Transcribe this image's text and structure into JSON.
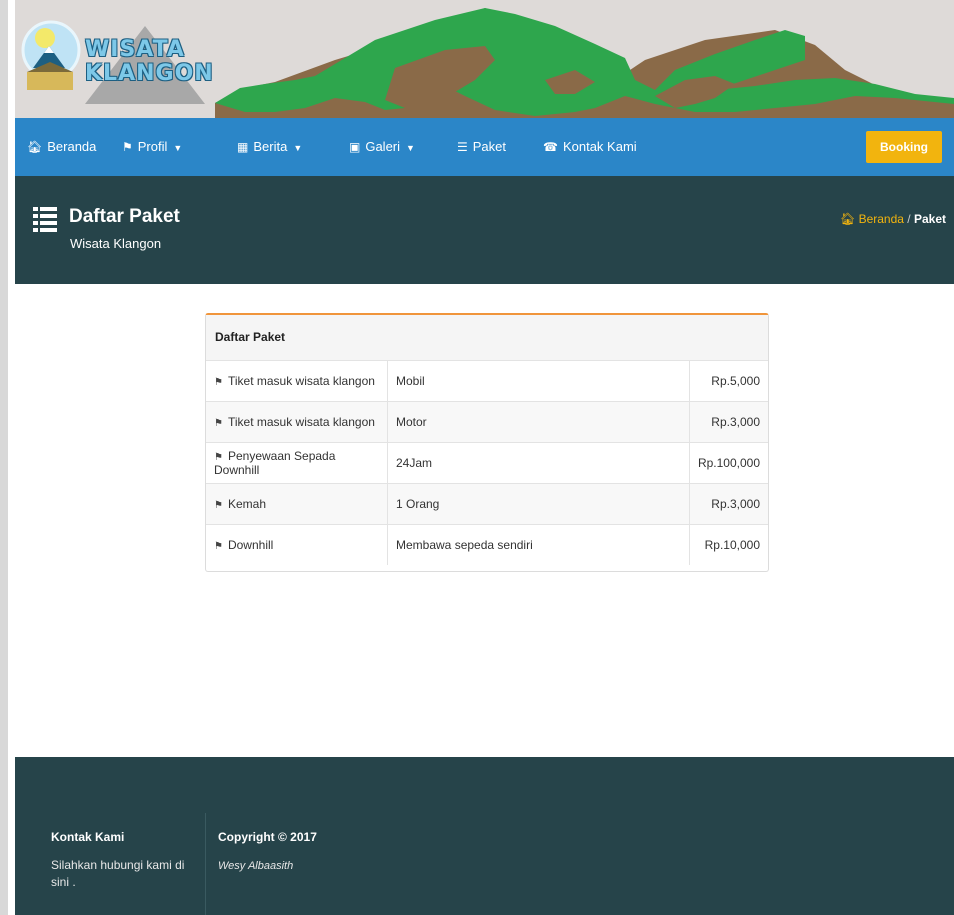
{
  "site": {
    "logo_line1": "WISATA",
    "logo_line2": "KLANGON"
  },
  "nav": {
    "items": [
      {
        "icon": "home-icon",
        "label": "Beranda",
        "dropdown": false
      },
      {
        "icon": "flag-icon",
        "label": "Profil",
        "dropdown": true
      },
      {
        "icon": "newspaper-icon",
        "label": "Berita",
        "dropdown": true
      },
      {
        "icon": "image-icon",
        "label": "Galeri",
        "dropdown": true
      },
      {
        "icon": "list-icon",
        "label": "Paket",
        "dropdown": false
      },
      {
        "icon": "phone-icon",
        "label": "Kontak Kami",
        "dropdown": false
      }
    ],
    "booking_label": "Booking"
  },
  "page_header": {
    "title": "Daftar Paket",
    "subtitle": "Wisata Klangon",
    "breadcrumb_home": "Beranda",
    "breadcrumb_separator": "/",
    "breadcrumb_current": "Paket"
  },
  "paket_table": {
    "heading": "Daftar Paket",
    "rows": [
      {
        "name": "Tiket masuk wisata klangon",
        "detail": "Mobil",
        "price": "Rp.5,000"
      },
      {
        "name": "Tiket masuk wisata klangon",
        "detail": "Motor",
        "price": "Rp.3,000"
      },
      {
        "name": "Penyewaan Sepada Downhill",
        "detail": "24Jam",
        "price": "Rp.100,000"
      },
      {
        "name": "Kemah",
        "detail": "1 Orang",
        "price": "Rp.3,000"
      },
      {
        "name": "Downhill",
        "detail": "Membawa sepeda sendiri",
        "price": "Rp.10,000"
      }
    ]
  },
  "footer": {
    "contact_heading": "Kontak Kami",
    "contact_text": "Silahkan hubungi kami di sini .",
    "copyright_heading": "Copyright © 2017",
    "author": "Wesy Albaasith"
  },
  "colors": {
    "nav_bg": "#2b86c8",
    "header_bg": "#26444a",
    "booking_bg": "#f2b40e",
    "panel_accent": "#f0953b"
  }
}
